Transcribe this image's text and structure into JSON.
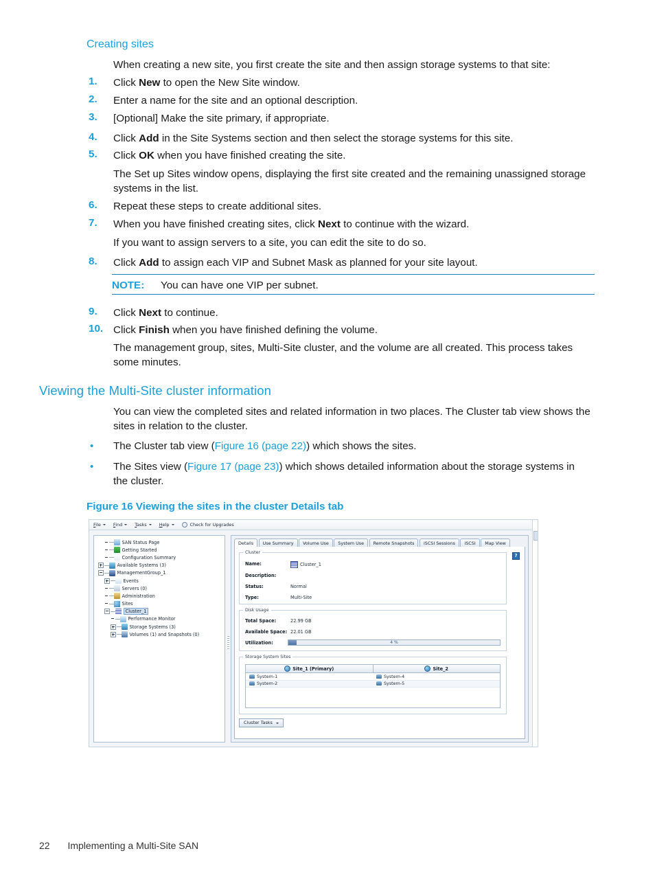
{
  "document": {
    "section1": {
      "heading": "Creating sites",
      "intro": "When creating a new site, you first create the site and then assign storage systems to that site:",
      "steps": [
        {
          "num": "1.",
          "html": "Click <b>New</b> to open the New Site window."
        },
        {
          "num": "2.",
          "html": "Enter a name for the site and an optional description."
        },
        {
          "num": "3.",
          "html": "[Optional] Make the site primary, if appropriate."
        },
        {
          "num": "4.",
          "html": "Click <b>Add</b> in the Site Systems section and then select the storage systems for this site."
        },
        {
          "num": "5.",
          "html": "Click <b>OK</b> when you have finished creating the site."
        },
        {
          "num": "6.",
          "html": "Repeat these steps to create additional sites."
        },
        {
          "num": "7.",
          "html": "When you have finished creating sites, click <b>Next</b> to continue with the wizard."
        },
        {
          "num": "8.",
          "html": "Click <b>Add</b> to assign each VIP and Subnet Mask as planned for your site layout."
        },
        {
          "num": "9.",
          "html": "Click <b>Next</b> to continue."
        },
        {
          "num": "10.",
          "html": "Click <b>Finish</b> when you have finished defining the volume."
        }
      ],
      "after_step5": "The Set up Sites window opens, displaying the first site created and the remaining unassigned storage systems in the list.",
      "after_step7": "If you want to assign servers to a site, you can edit the site to do so.",
      "after_step10": "The management group, sites, Multi-Site cluster, and the volume are all created. This process takes some minutes.",
      "note_label": "NOTE:",
      "note_text": "You can have one VIP per subnet."
    },
    "section2": {
      "heading": "Viewing the Multi-Site cluster information",
      "intro": "You can view the completed sites and related information in two places. The Cluster tab view shows the sites in relation to the cluster.",
      "bullets": [
        {
          "dot": "•",
          "html": "The Cluster tab view (<span class=\"link\">Figure 16 (page 22)</span>) which shows the sites."
        },
        {
          "dot": "•",
          "html": "The Sites view (<span class=\"link\">Figure 17 (page 23)</span>) which shows detailed information about the storage systems in the cluster."
        }
      ],
      "figure_caption": "Figure 16 Viewing the sites in the cluster Details tab"
    },
    "footer": {
      "page_number": "22",
      "chapter": "Implementing a Multi-Site SAN"
    },
    "colors": {
      "heading_blue": "#1ba0dd",
      "link_blue": "#1ba0dd",
      "note_rule": "#1b7fbf",
      "body_text": "#1a1a1a"
    }
  },
  "figure16": {
    "menubar": [
      {
        "label": "File",
        "underline": "F",
        "caret": true,
        "icon": null
      },
      {
        "label": "Find",
        "underline": "F",
        "caret": true,
        "icon": null
      },
      {
        "label": "Tasks",
        "underline": "T",
        "caret": true,
        "icon": null
      },
      {
        "label": "Help",
        "underline": "H",
        "caret": true,
        "icon": null
      },
      {
        "label": "Check for Upgrades",
        "underline": "",
        "caret": false,
        "icon": "upgrade-icon"
      }
    ],
    "tree": [
      {
        "label": "SAN Status Page",
        "depth": 1,
        "twist": "none",
        "icon": "san-status-icon",
        "selected": false
      },
      {
        "label": "Getting Started",
        "depth": 1,
        "twist": "none",
        "icon": "getting-started-icon",
        "selected": false
      },
      {
        "label": "Configuration Summary",
        "depth": 1,
        "twist": "none",
        "icon": "config-summary-icon",
        "selected": false
      },
      {
        "label": "Available Systems (3)",
        "depth": 0,
        "twist": "plus",
        "icon": "available-systems-icon",
        "selected": false
      },
      {
        "label": "ManagementGroup_1",
        "depth": 0,
        "twist": "minus",
        "icon": "management-group-icon",
        "selected": false
      },
      {
        "label": "Events",
        "depth": 1,
        "twist": "plus",
        "icon": "events-icon",
        "selected": false
      },
      {
        "label": "Servers (0)",
        "depth": 1,
        "twist": "none",
        "icon": "servers-icon",
        "selected": false
      },
      {
        "label": "Administration",
        "depth": 1,
        "twist": "none",
        "icon": "administration-icon",
        "selected": false
      },
      {
        "label": "Sites",
        "depth": 1,
        "twist": "none",
        "icon": "sites-icon",
        "selected": false
      },
      {
        "label": "Cluster_1",
        "depth": 1,
        "twist": "minus",
        "icon": "cluster-icon",
        "selected": true
      },
      {
        "label": "Performance Monitor",
        "depth": 2,
        "twist": "none",
        "icon": "performance-monitor-icon",
        "selected": false
      },
      {
        "label": "Storage Systems (3)",
        "depth": 2,
        "twist": "plus",
        "icon": "storage-systems-icon",
        "selected": false
      },
      {
        "label": "Volumes (1) and Snapshots (0)",
        "depth": 2,
        "twist": "plus",
        "icon": "volumes-icon",
        "selected": false
      }
    ],
    "tabs": [
      {
        "label": "Details",
        "active": true
      },
      {
        "label": "Use Summary",
        "active": false
      },
      {
        "label": "Volume Use",
        "active": false
      },
      {
        "label": "System Use",
        "active": false
      },
      {
        "label": "Remote Snapshots",
        "active": false
      },
      {
        "label": "iSCSI Sessions",
        "active": false
      },
      {
        "label": "iSCSI",
        "active": false
      },
      {
        "label": "Map View",
        "active": false
      }
    ],
    "cluster_group": {
      "title": "Cluster",
      "fields": [
        {
          "label": "Name:",
          "value": "Cluster_1",
          "icon": "cluster-icon"
        },
        {
          "label": "Description:",
          "value": "",
          "icon": null
        },
        {
          "label": "Status:",
          "value": "Normal",
          "icon": null
        },
        {
          "label": "Type:",
          "value": "Multi-Site",
          "icon": null
        }
      ],
      "help_button": "?"
    },
    "disk_usage_group": {
      "title": "Disk Usage",
      "total_space_label": "Total Space:",
      "total_space_value": "22.99 GB",
      "available_space_label": "Available Space:",
      "available_space_value": "22.01 GB",
      "utilization_label": "Utilization:",
      "utilization_percent": 4,
      "utilization_text": "4 %"
    },
    "storage_system_sites": {
      "title": "Storage System Sites",
      "columns": [
        "Site_1  (Primary)",
        "Site_2"
      ],
      "rows": [
        [
          "System-1",
          "System-4"
        ],
        [
          "System-2",
          "System-5"
        ]
      ]
    },
    "cluster_tasks_button": "Cluster Tasks"
  }
}
